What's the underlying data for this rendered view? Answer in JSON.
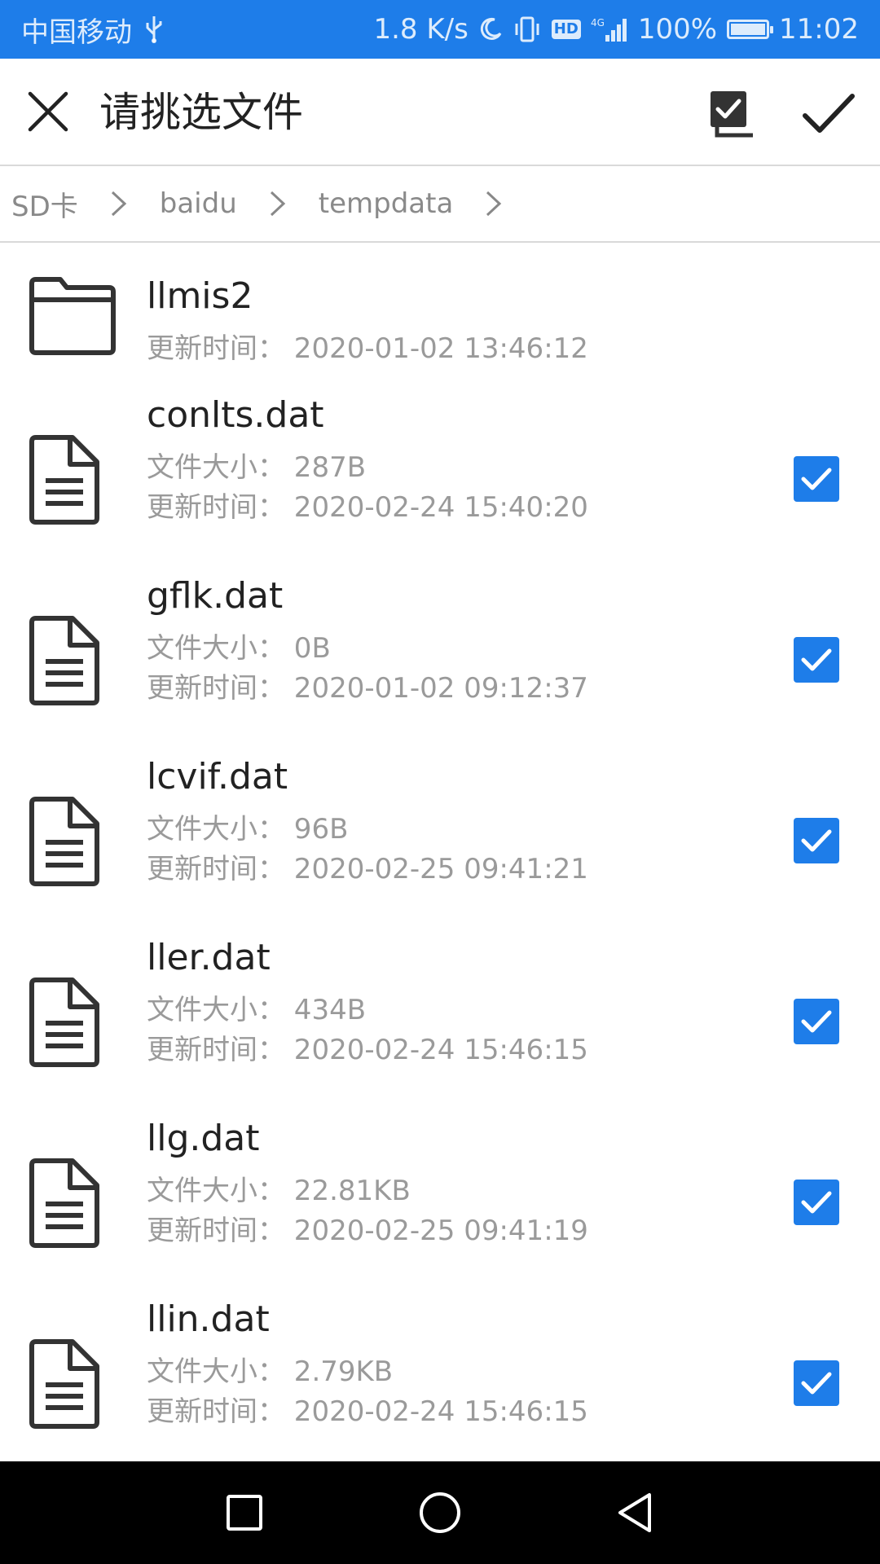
{
  "status_bar": {
    "carrier": "中国移动",
    "usb_icon": "usb-icon",
    "net_speed": "1.8 K/s",
    "moon_icon": "moon-icon",
    "vibrate_icon": "vibrate-icon",
    "hd": "HD",
    "signal_label": "4G",
    "battery": "100%",
    "battery_level": 1.0,
    "time": "11:02",
    "bg_color": "#1e7de9"
  },
  "toolbar": {
    "title": "请挑选文件",
    "close_icon": "close-icon",
    "select_all_icon": "select-all-icon",
    "confirm_icon": "check-icon"
  },
  "breadcrumb": [
    "SD卡",
    "baidu",
    "tempdata"
  ],
  "files": [
    {
      "name": "llmis2",
      "type": "folder",
      "size": "",
      "time": "更新时间： 2020-01-02 13:46:12",
      "checked": false
    },
    {
      "name": "conlts.dat",
      "type": "file",
      "size": "文件大小： 287B",
      "time": "更新时间： 2020-02-24 15:40:20",
      "checked": true
    },
    {
      "name": "gflk.dat",
      "type": "file",
      "size": "文件大小： 0B",
      "time": "更新时间： 2020-01-02 09:12:37",
      "checked": true
    },
    {
      "name": "lcvif.dat",
      "type": "file",
      "size": "文件大小： 96B",
      "time": "更新时间： 2020-02-25 09:41:21",
      "checked": true
    },
    {
      "name": "ller.dat",
      "type": "file",
      "size": "文件大小： 434B",
      "time": "更新时间： 2020-02-24 15:46:15",
      "checked": true
    },
    {
      "name": "llg.dat",
      "type": "file",
      "size": "文件大小： 22.81KB",
      "time": "更新时间： 2020-02-25 09:41:19",
      "checked": true
    },
    {
      "name": "llin.dat",
      "type": "file",
      "size": "文件大小： 2.79KB",
      "time": "更新时间： 2020-02-24 15:46:15",
      "checked": true
    }
  ],
  "nav": {
    "recents_icon": "square-icon",
    "home_icon": "circle-icon",
    "back_icon": "triangle-back-icon"
  }
}
